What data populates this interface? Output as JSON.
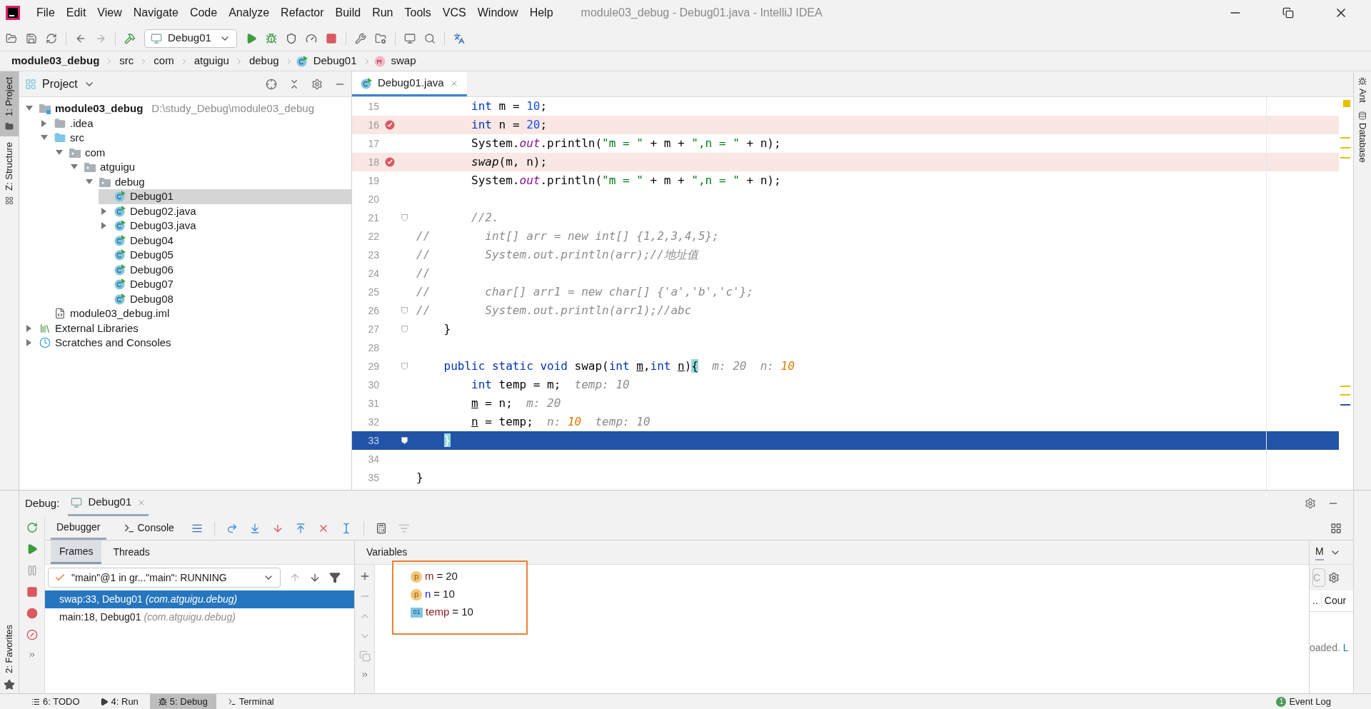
{
  "menu": [
    "File",
    "Edit",
    "View",
    "Navigate",
    "Code",
    "Analyze",
    "Refactor",
    "Build",
    "Run",
    "Tools",
    "VCS",
    "Window",
    "Help"
  ],
  "window_title": "module03_debug - Debug01.java - IntelliJ IDEA",
  "run_config": "Debug01",
  "breadcrumbs": [
    {
      "text": "module03_debug",
      "kind": "module"
    },
    {
      "text": "src",
      "kind": "folder"
    },
    {
      "text": "com",
      "kind": "folder"
    },
    {
      "text": "atguigu",
      "kind": "folder"
    },
    {
      "text": "debug",
      "kind": "folder"
    },
    {
      "text": "Debug01",
      "kind": "class"
    },
    {
      "text": "swap",
      "kind": "method"
    }
  ],
  "left_tabs": [
    {
      "label": "1: Project",
      "selected": true,
      "kind": "project"
    },
    {
      "label": "Z: Structure",
      "selected": false,
      "kind": "structure"
    }
  ],
  "favorites_tab": "2: Favorites",
  "project": {
    "title": "Project",
    "tree": [
      {
        "label": "module03_debug",
        "path": "D:\\study_Debug\\module03_debug",
        "kind": "module",
        "expanded": true,
        "selected": false,
        "children": [
          {
            "label": ".idea",
            "kind": "folder",
            "expanded": false,
            "selected": false
          },
          {
            "label": "src",
            "kind": "source",
            "expanded": true,
            "selected": false,
            "children": [
              {
                "label": "com",
                "kind": "package",
                "expanded": true,
                "selected": false,
                "children": [
                  {
                    "label": "atguigu",
                    "kind": "package",
                    "expanded": true,
                    "selected": false,
                    "children": [
                      {
                        "label": "debug",
                        "kind": "package",
                        "expanded": true,
                        "selected": false,
                        "children": [
                          {
                            "label": "Debug01",
                            "kind": "class",
                            "selected": true
                          },
                          {
                            "label": "Debug02.java",
                            "kind": "class",
                            "expanded": false,
                            "selected": false
                          },
                          {
                            "label": "Debug03.java",
                            "kind": "class",
                            "expanded": false,
                            "selected": false
                          },
                          {
                            "label": "Debug04",
                            "kind": "class",
                            "selected": false
                          },
                          {
                            "label": "Debug05",
                            "kind": "class",
                            "selected": false
                          },
                          {
                            "label": "Debug06",
                            "kind": "class",
                            "selected": false
                          },
                          {
                            "label": "Debug07",
                            "kind": "class",
                            "selected": false
                          },
                          {
                            "label": "Debug08",
                            "kind": "class",
                            "selected": false
                          }
                        ]
                      }
                    ]
                  }
                ]
              }
            ]
          },
          {
            "label": "module03_debug.iml",
            "kind": "iml",
            "selected": false
          }
        ]
      },
      {
        "label": "External Libraries",
        "kind": "libraries",
        "expanded": false,
        "selected": false
      },
      {
        "label": "Scratches and Consoles",
        "kind": "scratches",
        "expanded": false,
        "selected": false
      }
    ]
  },
  "editor": {
    "tabs": [
      {
        "label": "Debug01.java",
        "selected": true
      }
    ],
    "lines": [
      {
        "n": "15",
        "bp": false,
        "cur": false,
        "fold": false,
        "t": [
          {
            "kind": "kw",
            "t": "        int"
          },
          {
            "kind": "p",
            "t": " m = "
          },
          {
            "kind": "num",
            "t": "10"
          },
          {
            "kind": "p",
            "t": ";"
          }
        ]
      },
      {
        "n": "16",
        "bp": true,
        "cur": false,
        "fold": false,
        "t": [
          {
            "kind": "kw",
            "t": "        int"
          },
          {
            "kind": "p",
            "t": " n = "
          },
          {
            "kind": "num",
            "t": "20"
          },
          {
            "kind": "p",
            "t": ";"
          }
        ]
      },
      {
        "n": "17",
        "bp": false,
        "cur": false,
        "fold": false,
        "t": [
          {
            "kind": "p",
            "t": "        System."
          },
          {
            "kind": "fld",
            "t": "out"
          },
          {
            "kind": "p",
            "t": ".println("
          },
          {
            "kind": "str",
            "t": "\"m = \""
          },
          {
            "kind": "p",
            "t": " + m + "
          },
          {
            "kind": "str",
            "t": "\",n = \""
          },
          {
            "kind": "p",
            "t": " + n);"
          }
        ]
      },
      {
        "n": "18",
        "bp": true,
        "cur": false,
        "fold": false,
        "t": [
          {
            "kind": "it",
            "t": "        swap"
          },
          {
            "kind": "p",
            "t": "(m, n);"
          }
        ]
      },
      {
        "n": "19",
        "bp": false,
        "cur": false,
        "fold": false,
        "t": [
          {
            "kind": "p",
            "t": "        System."
          },
          {
            "kind": "fld",
            "t": "out"
          },
          {
            "kind": "p",
            "t": ".println("
          },
          {
            "kind": "str",
            "t": "\"m = \""
          },
          {
            "kind": "p",
            "t": " + m + "
          },
          {
            "kind": "str",
            "t": "\",n = \""
          },
          {
            "kind": "p",
            "t": " + n);"
          }
        ]
      },
      {
        "n": "20",
        "bp": false,
        "cur": false,
        "fold": false
      },
      {
        "n": "21",
        "bp": false,
        "cur": false,
        "fold": true,
        "t": [
          {
            "kind": "cm",
            "t": "        //2."
          }
        ]
      },
      {
        "n": "22",
        "bp": false,
        "cur": false,
        "fold": false,
        "t": [
          {
            "kind": "cm",
            "t": "//        int[] arr = new int[] {1,2,3,4,5};"
          }
        ]
      },
      {
        "n": "23",
        "bp": false,
        "cur": false,
        "fold": false,
        "t": [
          {
            "kind": "cm",
            "t": "//        System.out.println(arr);//地址值"
          }
        ]
      },
      {
        "n": "24",
        "bp": false,
        "cur": false,
        "fold": false,
        "t": [
          {
            "kind": "cm",
            "t": "//"
          }
        ]
      },
      {
        "n": "25",
        "bp": false,
        "cur": false,
        "fold": false,
        "t": [
          {
            "kind": "cm",
            "t": "//        char[] arr1 = new char[] {'a','b','c'};"
          }
        ]
      },
      {
        "n": "26",
        "bp": false,
        "cur": false,
        "fold": true,
        "t": [
          {
            "kind": "cm",
            "t": "//        System.out.println(arr1);//abc"
          }
        ]
      },
      {
        "n": "27",
        "bp": false,
        "cur": false,
        "fold": true,
        "t": [
          {
            "kind": "p",
            "t": "    }"
          }
        ]
      },
      {
        "n": "28",
        "bp": false,
        "cur": false,
        "fold": false
      },
      {
        "n": "29",
        "bp": false,
        "cur": false,
        "fold": true,
        "t": [
          {
            "kind": "kw",
            "t": "    public static void "
          },
          {
            "kind": "p",
            "t": "swap("
          },
          {
            "kind": "kw",
            "t": "int "
          },
          {
            "kind": "ul",
            "t": "m"
          },
          {
            "kind": "p",
            "t": ","
          },
          {
            "kind": "kw",
            "t": "int "
          },
          {
            "kind": "ul",
            "t": "n"
          },
          {
            "kind": "p",
            "t": ")"
          },
          {
            "kind": "br",
            "t": "{"
          },
          {
            "kind": "h",
            "t": "  m: 20  n: "
          },
          {
            "kind": "hc",
            "t": "10"
          }
        ]
      },
      {
        "n": "30",
        "bp": false,
        "cur": false,
        "fold": false,
        "t": [
          {
            "kind": "kw",
            "t": "        int"
          },
          {
            "kind": "p",
            "t": " temp = m;"
          },
          {
            "kind": "h",
            "t": "  temp: 10"
          }
        ]
      },
      {
        "n": "31",
        "bp": false,
        "cur": false,
        "fold": false,
        "t": [
          {
            "kind": "ul",
            "t": "        m"
          },
          {
            "kind": "p",
            "t": " = n;"
          },
          {
            "kind": "h",
            "t": "  m: 20"
          }
        ]
      },
      {
        "n": "32",
        "bp": false,
        "cur": false,
        "fold": false,
        "t": [
          {
            "kind": "ul",
            "t": "        n"
          },
          {
            "kind": "p",
            "t": " = temp;"
          },
          {
            "kind": "h",
            "t": "  n: "
          },
          {
            "kind": "hc",
            "t": "10"
          },
          {
            "kind": "h",
            "t": "  temp: 10"
          }
        ]
      },
      {
        "n": "33",
        "bp": false,
        "cur": true,
        "fold": true,
        "t": [
          {
            "kind": "br",
            "t": "    }"
          }
        ]
      },
      {
        "n": "34",
        "bp": false,
        "cur": false,
        "fold": false
      },
      {
        "n": "35",
        "bp": false,
        "cur": false,
        "fold": false,
        "t": [
          {
            "kind": "p",
            "t": "}"
          }
        ]
      }
    ]
  },
  "right_tabs": [
    {
      "label": "Ant",
      "kind": "ant"
    },
    {
      "label": "Database",
      "kind": "database"
    }
  ],
  "debug": {
    "label": "Debug:",
    "session": "Debug01",
    "tabs": [
      {
        "label": "Debugger",
        "selected": true,
        "kind": "debugger"
      },
      {
        "label": "Console",
        "selected": false,
        "kind": "console"
      }
    ],
    "frame_tabs": [
      {
        "label": "Frames",
        "selected": true
      },
      {
        "label": "Threads",
        "selected": false
      }
    ],
    "thread": "\"main\"@1 in gr...\"main\": RUNNING",
    "frames": [
      {
        "method": "swap:33, Debug01",
        "package": "(com.atguigu.debug)",
        "selected": true
      },
      {
        "method": "main:18, Debug01",
        "package": "(com.atguigu.debug)",
        "selected": false
      }
    ],
    "variables_title": "Variables",
    "variables": [
      {
        "kind": "param",
        "badge": "p",
        "name": "m",
        "sep": "=",
        "value": "20",
        "color": "#8b1a1a"
      },
      {
        "kind": "param",
        "badge": "p",
        "name": "n",
        "sep": "=",
        "value": "10",
        "color": "#1a1aff"
      },
      {
        "kind": "local",
        "badge": "01",
        "name": "temp",
        "sep": "=",
        "value": "10",
        "color": "#8b1a1a"
      }
    ],
    "side": {
      "tab": "M",
      "field": "C",
      "columns": [
        "..",
        "Cour"
      ],
      "message": "oaded.",
      "link": "L"
    }
  },
  "bottom_tabs": [
    {
      "label": "6: TODO",
      "selected": false,
      "kind": "todo"
    },
    {
      "label": "4: Run",
      "selected": false,
      "kind": "run"
    },
    {
      "label": "5: Debug",
      "selected": true,
      "kind": "debug"
    },
    {
      "label": "Terminal",
      "selected": false,
      "kind": "terminal"
    }
  ],
  "event_log": {
    "label": "Event Log",
    "count": "1"
  }
}
